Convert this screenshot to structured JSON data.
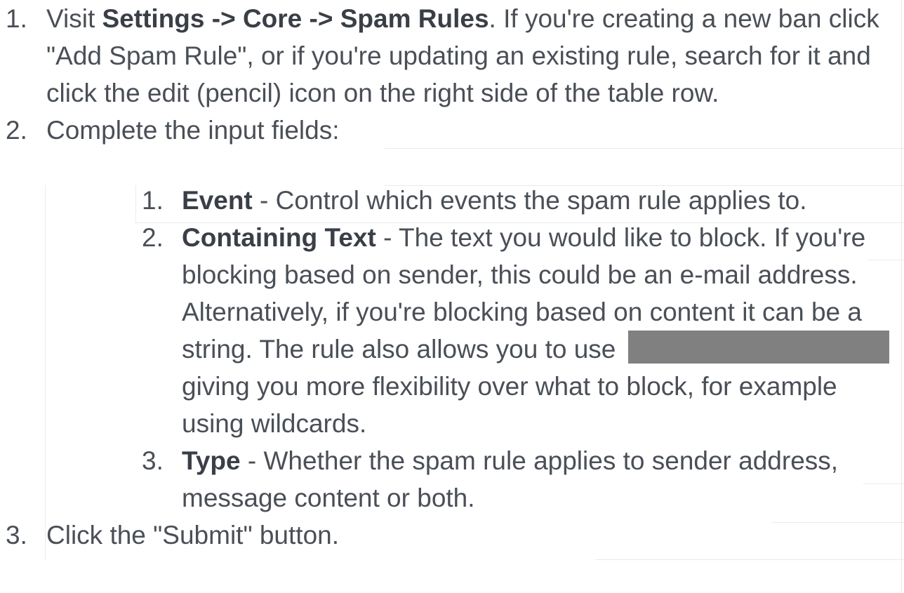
{
  "steps": [
    {
      "number": "1.",
      "prefix": "Visit ",
      "bold": "Settings -> Core -> Spam Rules",
      "suffix": ". If you're creating a new ban click \"Add Spam Rule\", or if you're updating an existing rule, search for it and click the edit (pencil) icon on the right side of the table row."
    },
    {
      "number": "2.",
      "text": "Complete the input fields:",
      "fields": [
        {
          "number": "1.",
          "bold": "Event",
          "text": " - Control which events the spam rule applies to."
        },
        {
          "number": "2.",
          "bold": "Containing Text",
          "text_before": " - The text you would like to block. If you're blocking based on sender, this could be an e-mail address. Alternatively, if you're blocking based on content it can be a string. The rule also allows you to use",
          "text_after": "giving you more flexibility over what to block, for example using wildcards."
        },
        {
          "number": "3.",
          "bold": "Type",
          "text": " - Whether the spam rule applies to sender address, message content or both."
        }
      ]
    },
    {
      "number": "3.",
      "text": "Click the \"Submit\" button."
    }
  ]
}
